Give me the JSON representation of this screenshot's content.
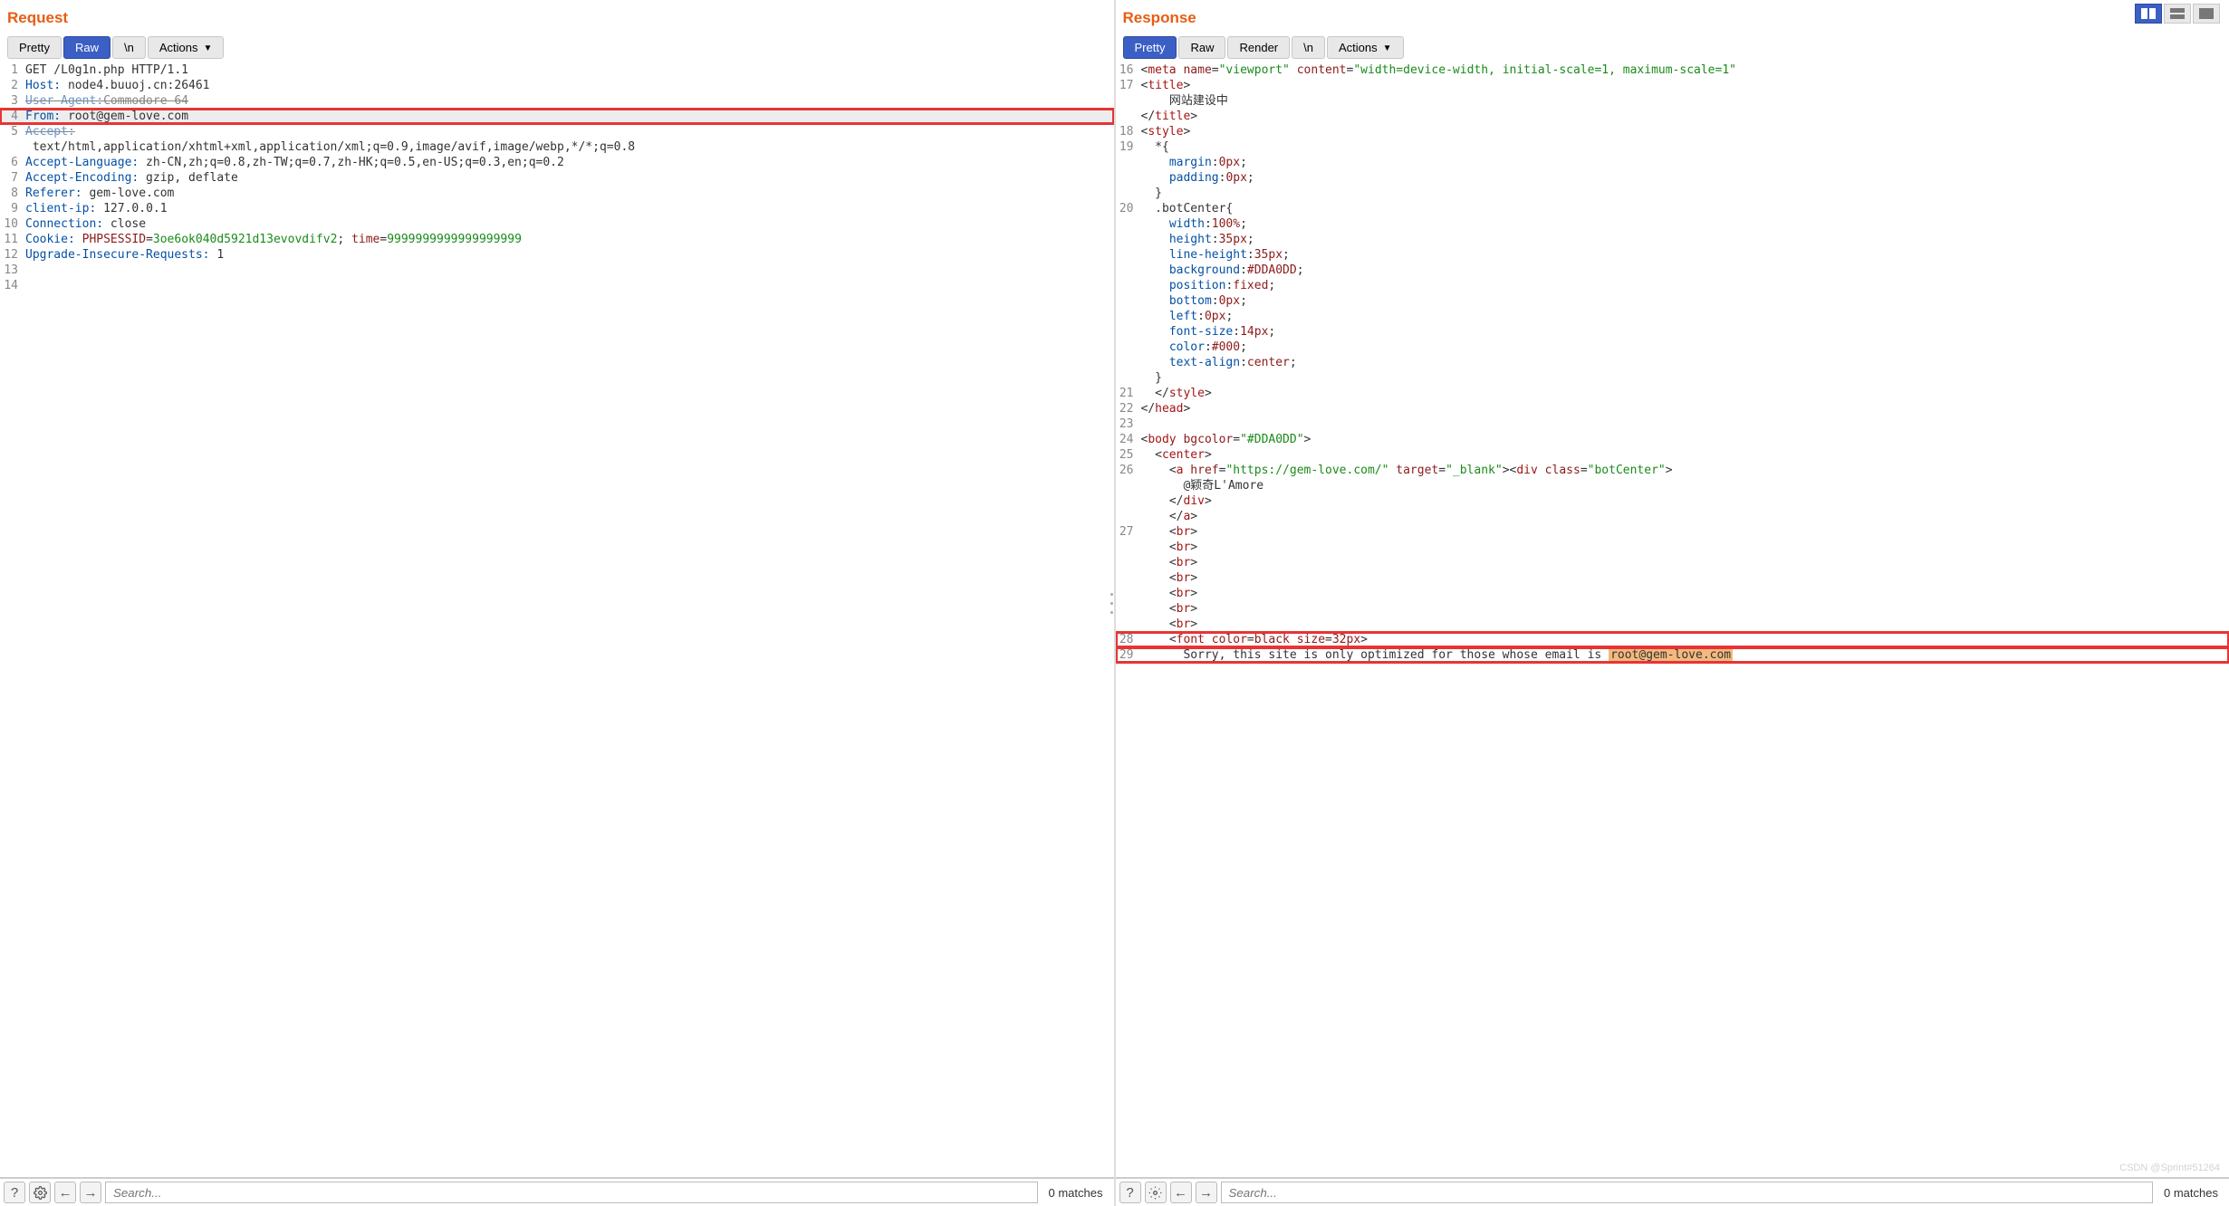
{
  "request": {
    "title": "Request",
    "tabs": [
      "Pretty",
      "Raw",
      "\\n",
      "Actions"
    ],
    "activeTab": "Raw",
    "lines": [
      {
        "n": "1",
        "plain": "GET /L0g1n.php HTTP/1.1"
      },
      {
        "n": "2",
        "header": "Host:",
        "val": " node4.buuoj.cn:26461"
      },
      {
        "n": "3",
        "header": "User-Agent:",
        "val": "Commodore 64",
        "strike": true
      },
      {
        "n": "4",
        "header": "From:",
        "val": " root@gem-love.com",
        "boxed": true,
        "hl": true
      },
      {
        "n": "5",
        "header": "Accept:",
        "val": " text/html,application/xhtml+xml,application/xml;q=0.9,image/avif,image/webp,*/*;q=0.8",
        "strike_prefix": true
      },
      {
        "n": "6",
        "header": "Accept-Language:",
        "val": " zh-CN,zh;q=0.8,zh-TW;q=0.7,zh-HK;q=0.5,en-US;q=0.3,en;q=0.2"
      },
      {
        "n": "7",
        "header": "Accept-Encoding:",
        "val": " gzip, deflate"
      },
      {
        "n": "8",
        "header": "Referer:",
        "val": " gem-love.com"
      },
      {
        "n": "9",
        "header": "client-ip:",
        "val": " 127.0.0.1"
      },
      {
        "n": "10",
        "header": "Connection:",
        "val": " close"
      },
      {
        "n": "11",
        "cookie": true,
        "header": "Cookie:",
        "k1": "PHPSESSID",
        "v1": "3oe6ok040d5921d13evovdifv2",
        "k2": "time",
        "v2": "9999999999999999999"
      },
      {
        "n": "12",
        "header": "Upgrade-Insecure-Requests:",
        "val": " 1"
      },
      {
        "n": "13",
        "plain": ""
      },
      {
        "n": "14",
        "plain": ""
      }
    ],
    "search_placeholder": "Search...",
    "matches": "0 matches"
  },
  "response": {
    "title": "Response",
    "tabs": [
      "Pretty",
      "Raw",
      "Render",
      "\\n",
      "Actions"
    ],
    "activeTab": "Pretty",
    "search_placeholder": "Search...",
    "matches": "0 matches",
    "code": {
      "l16": {
        "n": "16",
        "tag": "meta",
        "a1": "name",
        "v1": "viewport",
        "a2": "content",
        "v2": "width=device-width, initial-scale=1, maximum-scale=1"
      },
      "l17": {
        "n": "17",
        "tag_open": "title",
        "content": "网站建设中",
        "tag_close": "title"
      },
      "l18": {
        "n": "18",
        "tag_open": "style"
      },
      "l19": {
        "n": "19",
        "css": "*{ margin:0px; padding:0px; }"
      },
      "l20": {
        "n": "20",
        "css": ".botCenter{ width:100%; height:35px; line-height:35px; background:#DDA0DD; position:fixed; bottom:0px; left:0px; font-size:14px; color:#000; text-align:center; }"
      },
      "l21": {
        "n": "21",
        "tag_close": "style"
      },
      "l22": {
        "n": "22",
        "tag_close": "head"
      },
      "l23": {
        "n": "23",
        "plain": ""
      },
      "l24": {
        "n": "24",
        "tag": "body",
        "a1": "bgcolor",
        "v1": "#DDA0DD"
      },
      "l25": {
        "n": "25",
        "tag_open": "center"
      },
      "l26": {
        "n": "26",
        "tag": "a",
        "a1": "href",
        "v1": "https://gem-love.com/",
        "a2": "target",
        "v2": "_blank",
        "tag2": "div",
        "a3": "class",
        "v3": "botCenter",
        "inner": "@颖奇L'Amore",
        "close_div": "div",
        "close_a": "a"
      },
      "l27": {
        "n": "27",
        "br_count": 7
      },
      "l28": {
        "n": "28",
        "tag": "font",
        "a1": "color",
        "v1a": "black",
        "a2": "size",
        "v2a": "32px"
      },
      "l29": {
        "n": "29",
        "msg": "Sorry, this site is only optimized for those whose email is ",
        "email": "root@gem-love.com"
      }
    }
  },
  "watermark": "CSDN @Sprint#51264"
}
